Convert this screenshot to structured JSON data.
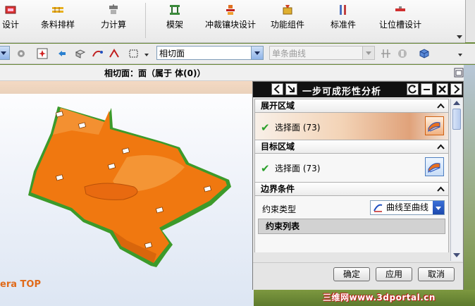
{
  "ribbon": {
    "items": [
      {
        "label": "设计",
        "icon": "die-design-icon"
      },
      {
        "label": "条料排样",
        "icon": "strip-layout-icon"
      },
      {
        "label": "力计算",
        "icon": "force-calculation-icon"
      },
      {
        "label": "模架",
        "icon": "die-base-icon"
      },
      {
        "label": "冲裁镶块设计",
        "icon": "punch-insert-icon"
      },
      {
        "label": "功能组件",
        "icon": "function-component-icon"
      },
      {
        "label": "标准件",
        "icon": "standard-part-icon"
      },
      {
        "label": "让位槽设计",
        "icon": "relief-slot-icon"
      }
    ]
  },
  "toolbar": {
    "face_filter_value": "相切面",
    "curve_filter_value": "单条曲线"
  },
  "status_line": "相切面：面（属于 体(0)）",
  "viewport": {
    "camera_label": "era TOP"
  },
  "dialog": {
    "title": "一步可成形性分析",
    "sections": {
      "unfold_region": {
        "title": "展开区域",
        "select_label": "选择面",
        "count": "(73)"
      },
      "target_region": {
        "title": "目标区域",
        "select_label": "选择面",
        "count": "(73)"
      },
      "boundary": {
        "title": "边界条件",
        "constraint_type_label": "约束类型",
        "constraint_type_value": "曲线至曲线",
        "constraint_list_title": "约束列表"
      }
    },
    "buttons": {
      "ok": "确定",
      "apply": "应用",
      "cancel": "取消"
    }
  },
  "watermark": "三维网www.3dportal.cn",
  "colors": {
    "part_orange": "#f07810",
    "part_edge_green": "#3c9a2a",
    "dialog_title_bg": "#111111",
    "check_green": "#2aa02a"
  }
}
